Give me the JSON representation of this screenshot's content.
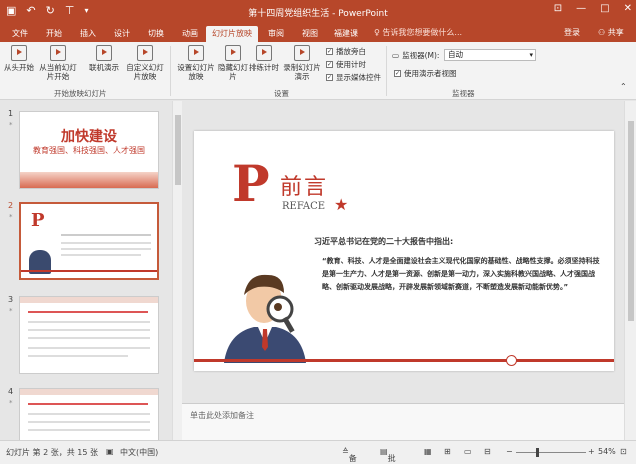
{
  "window": {
    "title": "第十四周党组织生活 - PowerPoint",
    "controls": [
      "—",
      "□",
      "✕"
    ],
    "qat_icons": [
      "save-icon",
      "undo-icon",
      "redo-icon",
      "start-slideshow-icon"
    ]
  },
  "tabs": [
    {
      "label": "文件",
      "active": false
    },
    {
      "label": "开始",
      "active": false
    },
    {
      "label": "插入",
      "active": false
    },
    {
      "label": "设计",
      "active": false
    },
    {
      "label": "切换",
      "active": false
    },
    {
      "label": "动画",
      "active": false
    },
    {
      "label": "幻灯片放映",
      "active": true
    },
    {
      "label": "审阅",
      "active": false
    },
    {
      "label": "视图",
      "active": false
    },
    {
      "label": "福建课",
      "active": false
    }
  ],
  "tell_me": "告诉我您想要做什么...",
  "account": {
    "login": "登录",
    "share": "共享"
  },
  "ribbon": {
    "groups": {
      "start": "开始放映幻灯片",
      "setup": "设置",
      "monitors": "监视器"
    },
    "buttons": {
      "from_start": "从头开始",
      "from_current": "从当前幻灯片开始",
      "online": "联机演示",
      "custom": "自定义幻灯片放映",
      "setup_show": "设置幻灯片放映",
      "hide": "隐藏幻灯片",
      "rehearse": "排练计时",
      "record": "录制幻灯片演示"
    },
    "checks": {
      "play_narrations": "播放旁白",
      "use_timings": "使用计时",
      "show_media_controls": "显示媒体控件",
      "use_presenter_view": "使用演示者视图"
    },
    "monitor_label": "监视器(M):",
    "monitor_value": "自动"
  },
  "thumbnails": {
    "numbers": [
      "1",
      "2",
      "3",
      "4"
    ],
    "slide1_title": "加快建设",
    "slide1_subtitle": "教育强国、科技强国、人才强国"
  },
  "slide": {
    "big_letter": "P",
    "title": "前言",
    "subtitle": "REFACE",
    "heading": "习近平总书记在党的二十大报告中指出:",
    "body": "“教育、科技、人才是全面建设社会主义现代化国家的基础性、战略性支撑。必须坚持科技是第一生产力、人才是第一资源、创新是第一动力，深入实施科教兴国战略、人才强国战略、创新驱动发展战略，开辟发展新领域新赛道，不断塑造发展新动能新优势。”"
  },
  "notes_placeholder": "单击此处添加备注",
  "status": {
    "slide_pos": "幻灯片 第 2 张，共 15 张",
    "language": "中文(中国)",
    "notes_btn": "备注",
    "comments_btn": "批注",
    "zoom": "54%"
  }
}
